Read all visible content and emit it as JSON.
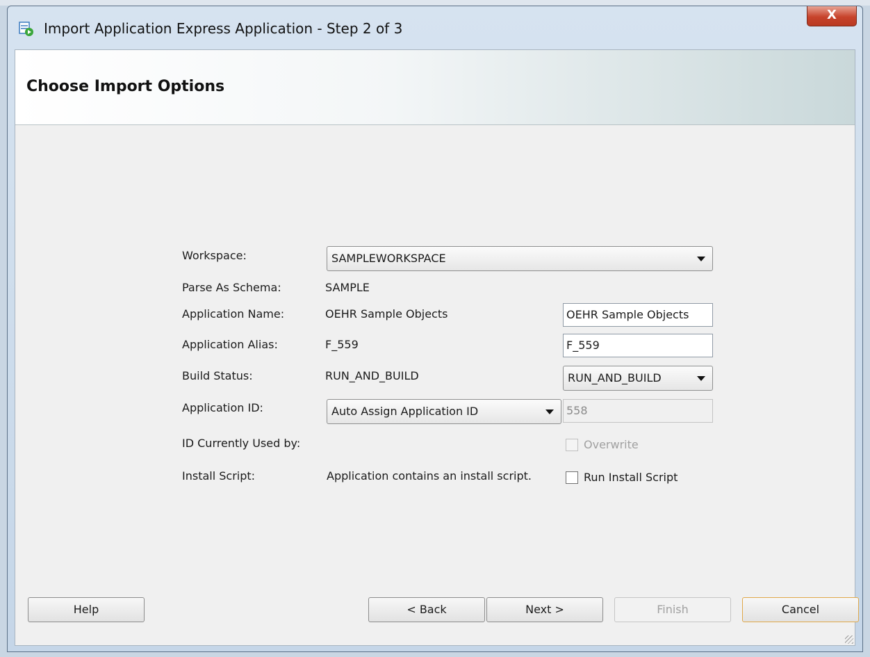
{
  "window": {
    "title": "Import Application Express Application - Step 2 of 3",
    "close_label": "X"
  },
  "header": {
    "title": "Choose Import Options"
  },
  "form": {
    "workspace": {
      "label": "Workspace:",
      "value": "SAMPLEWORKSPACE"
    },
    "parse_as_schema": {
      "label": "Parse As Schema:",
      "value": "SAMPLE"
    },
    "application_name": {
      "label": "Application Name:",
      "value": "OEHR Sample Objects",
      "input_value": "OEHR Sample Objects"
    },
    "application_alias": {
      "label": "Application Alias:",
      "value": "F_559",
      "input_value": "F_559"
    },
    "build_status": {
      "label": "Build Status:",
      "value": "RUN_AND_BUILD",
      "select_value": "RUN_AND_BUILD"
    },
    "application_id": {
      "label": "Application ID:",
      "select_value": "Auto Assign Application ID",
      "input_value": "558"
    },
    "id_currently_used_by": {
      "label": "ID Currently Used by:",
      "overwrite_label": "Overwrite",
      "overwrite_checked": false
    },
    "install_script": {
      "label": "Install Script:",
      "value": "Application contains an install script.",
      "run_label": "Run Install Script",
      "run_checked": false
    }
  },
  "buttons": {
    "help": "Help",
    "back": "< Back",
    "next": "Next >",
    "finish": "Finish",
    "cancel": "Cancel"
  },
  "colors": {
    "close_button": "#c7432b",
    "cancel_focus_border": "#e0a84a"
  }
}
